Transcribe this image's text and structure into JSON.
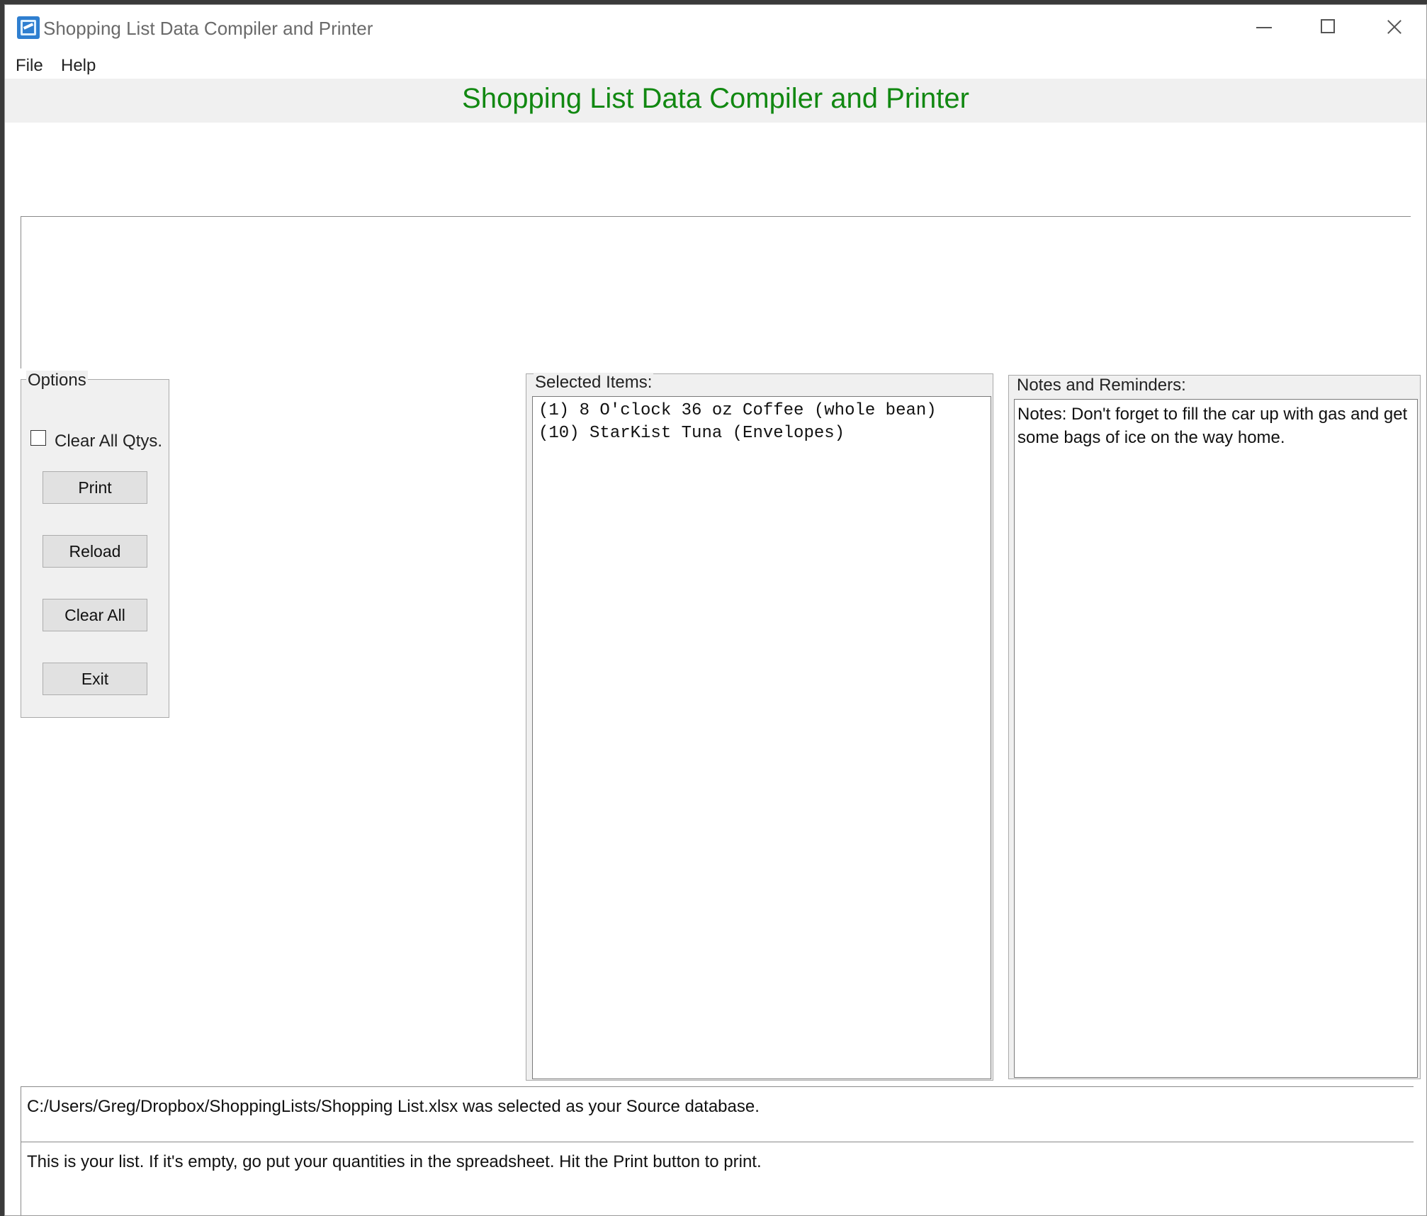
{
  "window": {
    "title": "Shopping List Data Compiler and Printer",
    "icon": "app-icon"
  },
  "menu": {
    "items": [
      {
        "label": "File"
      },
      {
        "label": "Help"
      }
    ]
  },
  "header": {
    "title": "Shopping List Data Compiler and Printer",
    "color": "#118811"
  },
  "options": {
    "group_label": "Options",
    "clear_qtys_label": "Clear All Qtys.",
    "clear_qtys_checked": false,
    "buttons": {
      "print": "Print",
      "reload": "Reload",
      "clear_all": "Clear All",
      "exit": "Exit"
    }
  },
  "selected": {
    "group_label": "Selected Items:",
    "items": [
      "(1) 8 O'clock 36 oz Coffee (whole bean)",
      "(10) StarKist Tuna (Envelopes)"
    ]
  },
  "notes": {
    "group_label": "Notes and Reminders:",
    "text": "Notes: Don't forget to fill the car up with gas and get some bags of ice on the way home."
  },
  "status": {
    "source": "C:/Users/Greg/Dropbox/ShoppingLists/Shopping List.xlsx was selected as your Source database.",
    "message": "This is your list. If it's empty, go put your quantities in the spreadsheet. Hit the Print button to print."
  }
}
